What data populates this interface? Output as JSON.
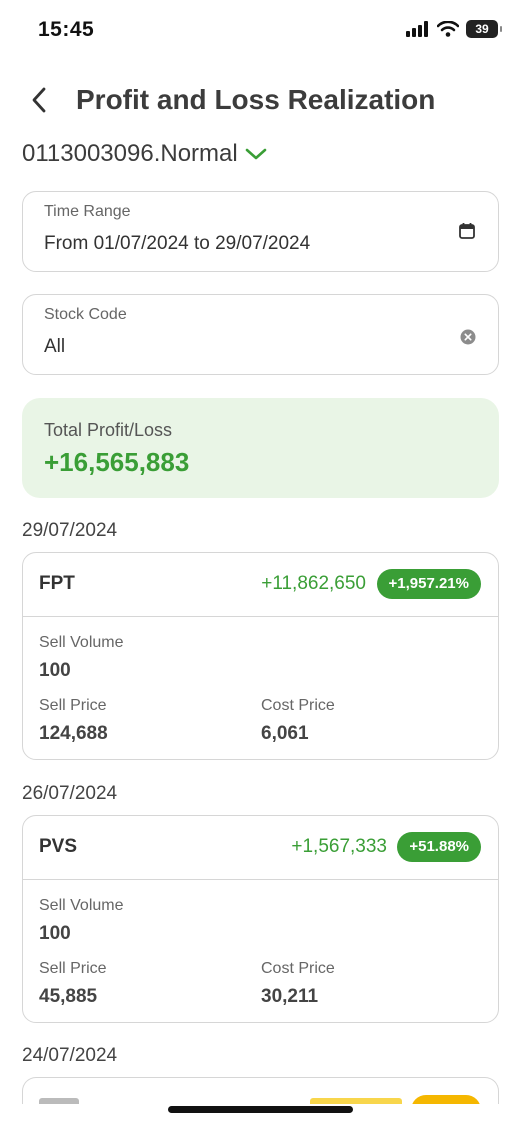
{
  "status_bar": {
    "time": "15:45",
    "battery": "39"
  },
  "header": {
    "title": "Profit and Loss Realization",
    "back_icon": "chevron-left-icon"
  },
  "account": {
    "label": "0113003096.Normal",
    "icon": "chevron-down-icon"
  },
  "time_range": {
    "label": "Time Range",
    "value": "From 01/07/2024 to 29/07/2024",
    "icon": "calendar-icon"
  },
  "stock_code": {
    "label": "Stock Code",
    "value": "All",
    "icon": "clear-icon"
  },
  "summary": {
    "label": "Total Profit/Loss",
    "value": "+16,565,883"
  },
  "groups": [
    {
      "date": "29/07/2024",
      "item": {
        "symbol": "FPT",
        "pl": "+11,862,650",
        "pl_percent": "+1,957.21%",
        "sell_volume_label": "Sell Volume",
        "sell_volume": "100",
        "sell_price_label": "Sell Price",
        "sell_price": "124,688",
        "cost_price_label": "Cost Price",
        "cost_price": "6,061"
      }
    },
    {
      "date": "26/07/2024",
      "item": {
        "symbol": "PVS",
        "pl": "+1,567,333",
        "pl_percent": "+51.88%",
        "sell_volume_label": "Sell Volume",
        "sell_volume": "100",
        "sell_price_label": "Sell Price",
        "sell_price": "45,885",
        "cost_price_label": "Cost Price",
        "cost_price": "30,211"
      }
    },
    {
      "date": "24/07/2024"
    }
  ],
  "colors": {
    "profit": "#3a9e36",
    "summary_bg": "#e9f5e6",
    "border": "#d6d6d6",
    "neutral_badge": "#f5b700"
  }
}
